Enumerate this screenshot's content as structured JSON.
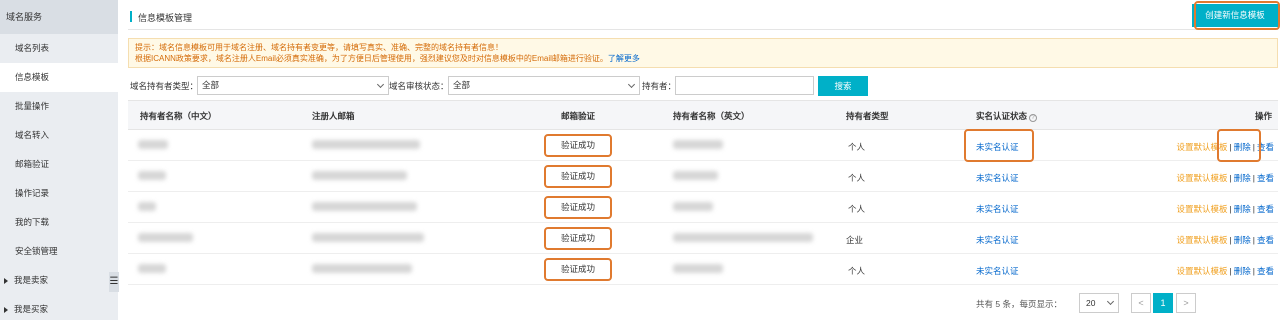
{
  "sidebar": {
    "title": "域名服务",
    "items": [
      {
        "label": "域名列表"
      },
      {
        "label": "信息模板"
      },
      {
        "label": "批量操作"
      },
      {
        "label": "域名转入"
      },
      {
        "label": "邮箱验证"
      },
      {
        "label": "操作记录"
      },
      {
        "label": "我的下载"
      },
      {
        "label": "安全锁管理"
      }
    ],
    "groups": [
      {
        "label": "我是卖家"
      },
      {
        "label": "我是买家"
      }
    ],
    "collapse_glyph": "☰"
  },
  "header": {
    "title": "信息模板管理",
    "create_label": "创建新信息模板"
  },
  "notice": {
    "line1": "提示：域名信息模板可用于域名注册、域名持有者变更等，请填写真实、准确、完整的域名持有者信息！",
    "line2": "根据ICANN政策要求，域名注册人Email必须真实准确，为了方便日后管理使用，强烈建议您及时对信息模板中的Email邮箱进行验证。",
    "link": "了解更多"
  },
  "filter": {
    "owner_type_label": "域名持有者类型：",
    "owner_type_value": "全部",
    "audit_label": "域名审核状态：",
    "audit_value": "全部",
    "holder_label": "持有者：",
    "holder_value": "",
    "search_label": "搜索"
  },
  "table": {
    "columns": [
      "持有者名称（中文）",
      "注册人邮箱",
      "邮箱验证",
      "持有者名称（英文）",
      "持有者类型",
      "实名认证状态",
      "操作"
    ],
    "rows": [
      {
        "email_verify": "验证成功",
        "type": "个人",
        "auth": "未实名认证"
      },
      {
        "email_verify": "验证成功",
        "type": "个人",
        "auth": "未实名认证"
      },
      {
        "email_verify": "验证成功",
        "type": "个人",
        "auth": "未实名认证"
      },
      {
        "email_verify": "验证成功",
        "type": "企业",
        "auth": "未实名认证"
      },
      {
        "email_verify": "验证成功",
        "type": "个人",
        "auth": "未实名认证"
      }
    ],
    "ops": {
      "set_default": "设置默认模板",
      "delete": "删除",
      "view": "查看",
      "separator": "|"
    }
  },
  "pager": {
    "summary": "共有 5 条，每页显示：",
    "page_size": "20",
    "prev": "<",
    "current": "1",
    "next": ">"
  },
  "colors": {
    "accent": "#00b0c8",
    "highlight": "#e07a2f",
    "link": "#0066cc",
    "warning": "#f0a020"
  }
}
